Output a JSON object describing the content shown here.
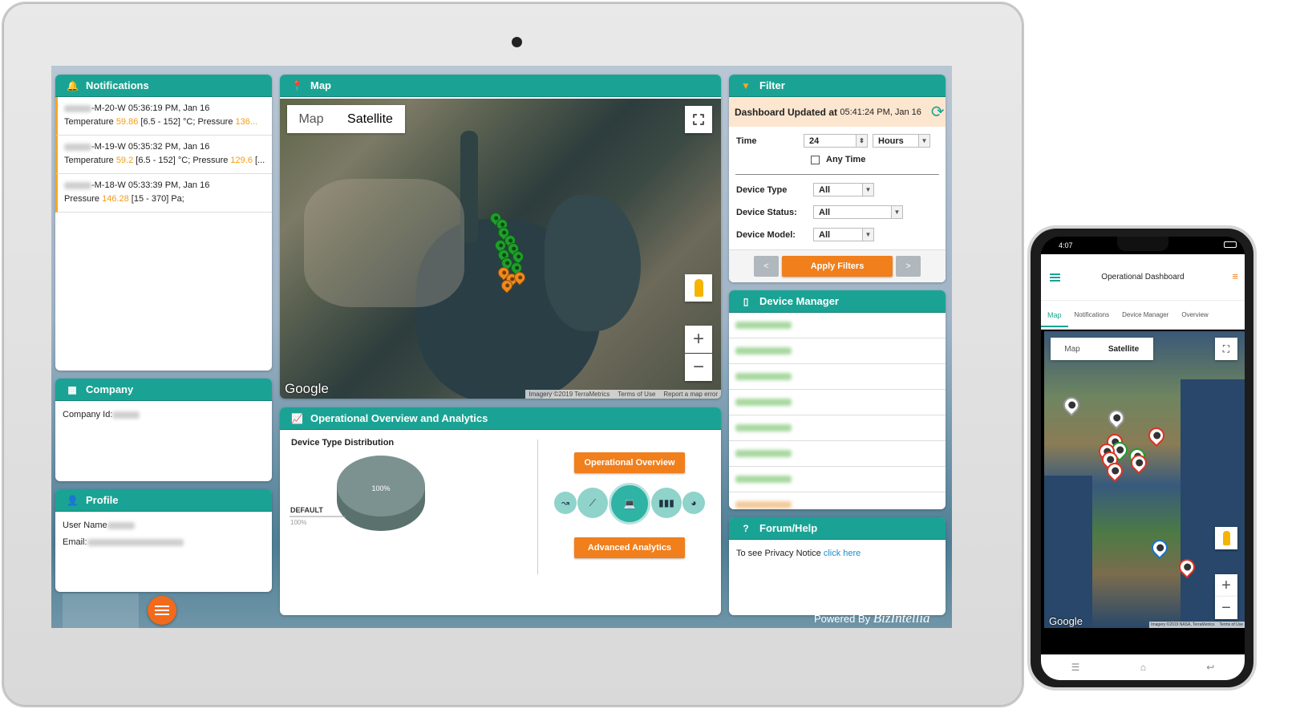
{
  "notifications": {
    "title": "Notifications",
    "items": [
      {
        "device": "-M-20-W 05:36:19 PM, Jan 16",
        "line_a": "Temperature ",
        "val_a": "59.86",
        "line_b": " [6.5 - 152] °C; Pressure ",
        "val_b": "136..."
      },
      {
        "device": "-M-19-W 05:35:32 PM, Jan 16",
        "line_a": "Temperature ",
        "val_a": "59.2",
        "line_b": " [6.5 - 152] °C; Pressure ",
        "val_b": "129.6",
        "tail": " [..."
      },
      {
        "device": "-M-18-W 05:33:39 PM, Jan 16",
        "line_a": "Pressure ",
        "val_a": "146.28",
        "line_b": " [15 - 370] Pa;"
      }
    ]
  },
  "company": {
    "title": "Company",
    "id_label": "Company Id:"
  },
  "profile": {
    "title": "Profile",
    "username_label": "User Name",
    "email_label": "Email:"
  },
  "map": {
    "title": "Map",
    "toggle_map": "Map",
    "toggle_satellite": "Satellite",
    "google": "Google",
    "attribution": "Imagery ©2019 TerraMetrics",
    "terms": "Terms of Use",
    "report": "Report a map error",
    "zoom_in": "+",
    "zoom_out": "−"
  },
  "filter": {
    "title": "Filter",
    "updated_label": "Dashboard Updated at",
    "updated_time": "05:41:24 PM, Jan 16",
    "time_label": "Time",
    "time_value": "24",
    "time_unit": "Hours",
    "any_time": "Any Time",
    "device_type_label": "Device Type",
    "device_type_value": "All",
    "device_status_label": "Device Status:",
    "device_status_value": "All",
    "device_model_label": "Device Model:",
    "device_model_value": "All",
    "prev": "<",
    "next": ">",
    "apply": "Apply Filters"
  },
  "device_manager": {
    "title": "Device Manager"
  },
  "analytics": {
    "title": "Operational Overview and Analytics",
    "chart_title": "Device Type Distribution",
    "pie_label": "100%",
    "legend_name": "DEFAULT",
    "legend_pct": "100%",
    "btn_overview": "Operational Overview",
    "btn_advanced": "Advanced Analytics"
  },
  "forum": {
    "title": "Forum/Help",
    "privacy_text": "To see Privacy Notice",
    "privacy_link": "click here"
  },
  "footer": {
    "powered": "Powered By",
    "brand": "BizIntellia"
  },
  "phone": {
    "time": "4:07",
    "title": "Operational Dashboard",
    "tabs": [
      "Map",
      "Notifications",
      "Device Manager",
      "Overview"
    ],
    "toggle_map": "Map",
    "toggle_satellite": "Satellite",
    "google": "Google",
    "attribution": "Imagery ©2019 NASA, TerraMetrics",
    "terms": "Terms of Use",
    "zoom_in": "+",
    "zoom_out": "−"
  },
  "colors": {
    "teal": "#1aa394",
    "orange": "#f07f1c",
    "green_pin": "#1f9e2c",
    "orange_pin": "#f08a1c"
  }
}
